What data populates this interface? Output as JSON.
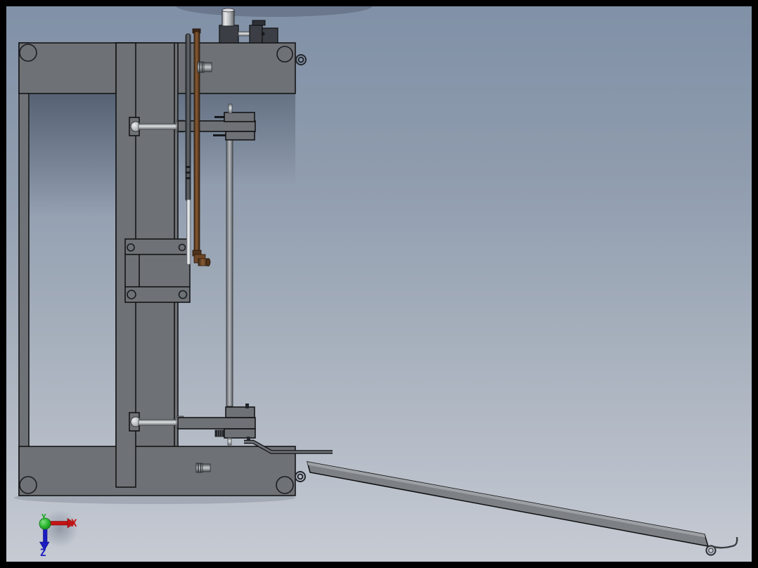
{
  "triad": {
    "x_label": "X",
    "y_label": "Y",
    "z_label": "Z"
  },
  "colors": {
    "background-top": "#8090a6",
    "background-bottom": "#c7cbd4",
    "body": "#6e7175",
    "dark-block": "#3b3f45",
    "outline": "#0e0f10",
    "copper": "#7a4f2a",
    "ramp": "#7d8084",
    "ramp-top": "#9da0a4",
    "axis-x": "#c41414",
    "axis-y": "#16a51a",
    "axis-z": "#1c1cc2",
    "border": "#000000"
  }
}
